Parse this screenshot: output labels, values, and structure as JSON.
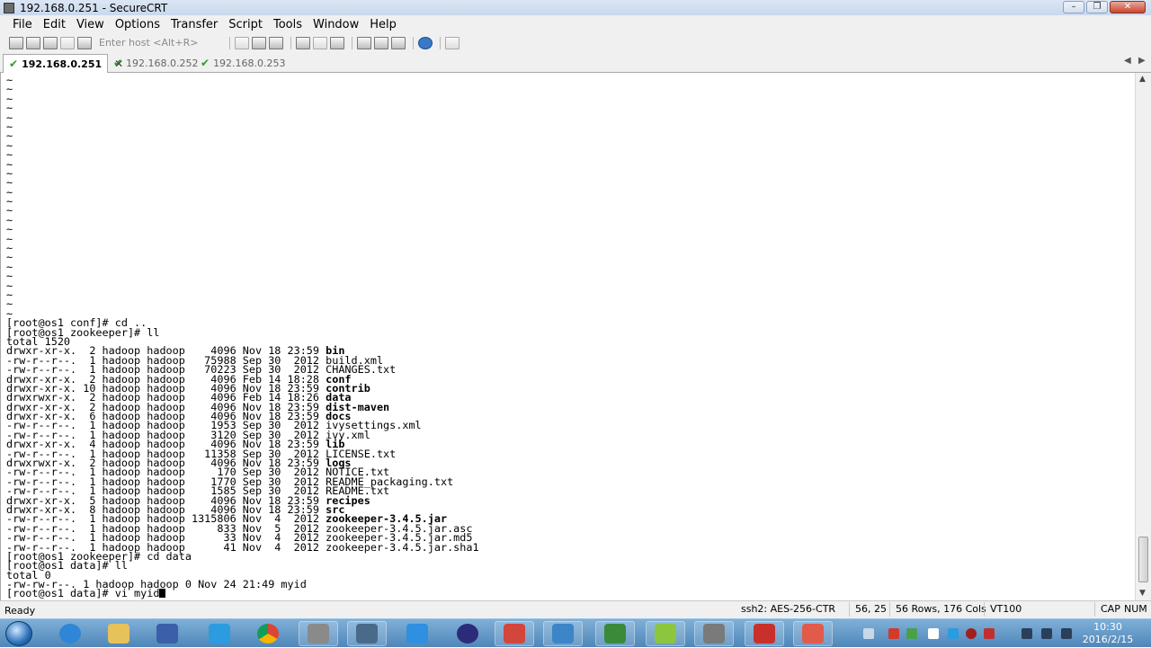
{
  "window": {
    "title": "192.168.0.251 - SecureCRT"
  },
  "menu": [
    "File",
    "Edit",
    "View",
    "Options",
    "Transfer",
    "Script",
    "Tools",
    "Window",
    "Help"
  ],
  "toolbar": {
    "host_placeholder": "Enter host <Alt+R>"
  },
  "tabs": [
    {
      "label": "192.168.0.251",
      "active": true
    },
    {
      "label": "192.168.0.252",
      "active": false
    },
    {
      "label": "192.168.0.253",
      "active": false
    }
  ],
  "terminal": {
    "tilde_lines": 26,
    "lines": [
      {
        "text": "[root@os1 conf]# cd .."
      },
      {
        "text": "[root@os1 zookeeper]# ll"
      },
      {
        "text": "total 1520"
      },
      {
        "meta": "drwxr-xr-x.  2 hadoop hadoop    4096 Nov 18 23:59 ",
        "name": "bin",
        "bold": true
      },
      {
        "meta": "-rw-r--r--.  1 hadoop hadoop   75988 Sep 30  2012 ",
        "name": "build.xml",
        "bold": false
      },
      {
        "meta": "-rw-r--r--.  1 hadoop hadoop   70223 Sep 30  2012 ",
        "name": "CHANGES.txt",
        "bold": false
      },
      {
        "meta": "drwxr-xr-x.  2 hadoop hadoop    4096 Feb 14 18:28 ",
        "name": "conf",
        "bold": true
      },
      {
        "meta": "drwxr-xr-x. 10 hadoop hadoop    4096 Nov 18 23:59 ",
        "name": "contrib",
        "bold": true
      },
      {
        "meta": "drwxrwxr-x.  2 hadoop hadoop    4096 Feb 14 18:26 ",
        "name": "data",
        "bold": true
      },
      {
        "meta": "drwxr-xr-x.  2 hadoop hadoop    4096 Nov 18 23:59 ",
        "name": "dist-maven",
        "bold": true
      },
      {
        "meta": "drwxr-xr-x.  6 hadoop hadoop    4096 Nov 18 23:59 ",
        "name": "docs",
        "bold": true
      },
      {
        "meta": "-rw-r--r--.  1 hadoop hadoop    1953 Sep 30  2012 ",
        "name": "ivysettings.xml",
        "bold": false
      },
      {
        "meta": "-rw-r--r--.  1 hadoop hadoop    3120 Sep 30  2012 ",
        "name": "ivy.xml",
        "bold": false
      },
      {
        "meta": "drwxr-xr-x.  4 hadoop hadoop    4096 Nov 18 23:59 ",
        "name": "lib",
        "bold": true
      },
      {
        "meta": "-rw-r--r--.  1 hadoop hadoop   11358 Sep 30  2012 ",
        "name": "LICENSE.txt",
        "bold": false
      },
      {
        "meta": "drwxrwxr-x.  2 hadoop hadoop    4096 Nov 18 23:59 ",
        "name": "logs",
        "bold": true
      },
      {
        "meta": "-rw-r--r--.  1 hadoop hadoop     170 Sep 30  2012 ",
        "name": "NOTICE.txt",
        "bold": false
      },
      {
        "meta": "-rw-r--r--.  1 hadoop hadoop    1770 Sep 30  2012 ",
        "name": "README_packaging.txt",
        "bold": false
      },
      {
        "meta": "-rw-r--r--.  1 hadoop hadoop    1585 Sep 30  2012 ",
        "name": "README.txt",
        "bold": false
      },
      {
        "meta": "drwxr-xr-x.  5 hadoop hadoop    4096 Nov 18 23:59 ",
        "name": "recipes",
        "bold": true
      },
      {
        "meta": "drwxr-xr-x.  8 hadoop hadoop    4096 Nov 18 23:59 ",
        "name": "src",
        "bold": true
      },
      {
        "meta": "-rw-r--r--.  1 hadoop hadoop 1315806 Nov  4  2012 ",
        "name": "zookeeper-3.4.5.jar",
        "bold": true
      },
      {
        "meta": "-rw-r--r--.  1 hadoop hadoop     833 Nov  5  2012 ",
        "name": "zookeeper-3.4.5.jar.asc",
        "bold": false
      },
      {
        "meta": "-rw-r--r--.  1 hadoop hadoop      33 Nov  4  2012 ",
        "name": "zookeeper-3.4.5.jar.md5",
        "bold": false
      },
      {
        "meta": "-rw-r--r--.  1 hadoop hadoop      41 Nov  4  2012 ",
        "name": "zookeeper-3.4.5.jar.sha1",
        "bold": false
      },
      {
        "text": "[root@os1 zookeeper]# cd data"
      },
      {
        "text": "[root@os1 data]# ll"
      },
      {
        "text": "total 0"
      },
      {
        "text": "-rw-rw-r--. 1 hadoop hadoop 0 Nov 24 21:49 myid"
      },
      {
        "text": "[root@os1 data]# vi myid",
        "cursor": true
      }
    ]
  },
  "statusbar": {
    "ready": "Ready",
    "cipher": "ssh2: AES-256-CTR",
    "position": "56,  25",
    "size": "56 Rows, 176 Cols",
    "emulation": "VT100",
    "caps": "CAP",
    "num": "NUM"
  },
  "clock": {
    "time": "10:30",
    "date": "2016/2/15"
  },
  "colors": {
    "title_bar": "#c9d8ec",
    "taskbar": "#4f86b9",
    "tab_check": "#2e9a2e"
  }
}
